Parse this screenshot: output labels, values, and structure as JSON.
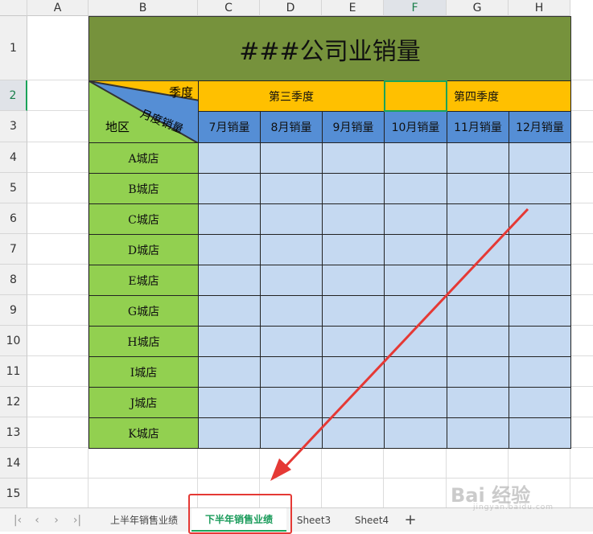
{
  "columns": [
    "A",
    "B",
    "C",
    "D",
    "E",
    "F",
    "G",
    "H"
  ],
  "rows": [
    "1",
    "2",
    "3",
    "4",
    "5",
    "6",
    "7",
    "8",
    "9",
    "10",
    "11",
    "12",
    "13",
    "14",
    "15"
  ],
  "title": "###公司业销量",
  "header": {
    "diag_top": "季度",
    "diag_mid": "月度销量",
    "diag_bottom": "地区",
    "q3": "第三季度",
    "q4": "第四季度",
    "months": [
      "7月销量",
      "8月销量",
      "9月销量",
      "10月销量",
      "11月销量",
      "12月销量"
    ]
  },
  "stores": [
    "A城店",
    "B城店",
    "C城店",
    "D城店",
    "E城店",
    "G城店",
    "H城店",
    "I城店",
    "J城店",
    "K城店"
  ],
  "active_cell": "F2",
  "tabs": [
    "上半年销售业绩",
    "下半年销售业绩",
    "Sheet3",
    "Sheet4"
  ],
  "active_tab": "下半年销售业绩",
  "add_sheet": "+",
  "nav_icons": [
    "first-sheet-icon",
    "prev-sheet-icon",
    "next-sheet-icon",
    "last-sheet-icon"
  ],
  "watermark": {
    "text": "Bai 经验",
    "sub": "jingyan.baidu.com"
  },
  "colors": {
    "title_bg": "#76923c",
    "quarter_bg": "#ffc000",
    "month_bg": "#558ed5",
    "store_bg": "#92d050",
    "data_bg": "#c5d9f1",
    "annotation": "#e53935",
    "selection": "#1aa35a"
  }
}
